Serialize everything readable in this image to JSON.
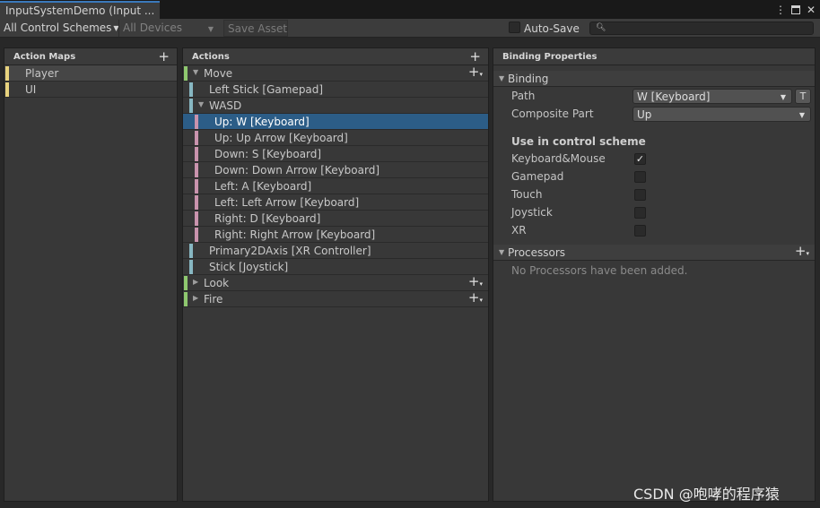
{
  "window": {
    "tab_title": "InputSystemDemo (Input ..."
  },
  "toolbar": {
    "control_schemes": "All Control Schemes",
    "devices": "All Devices",
    "save_asset": "Save Asset",
    "auto_save_label": "Auto-Save",
    "search_placeholder": ""
  },
  "action_maps": {
    "header": "Action Maps",
    "items": [
      {
        "label": "Player",
        "selected": true
      },
      {
        "label": "UI",
        "selected": false
      }
    ]
  },
  "actions": {
    "header": "Actions",
    "rows": [
      {
        "label": "Move",
        "kind": "action"
      },
      {
        "label": "Left Stick [Gamepad]",
        "kind": "binding"
      },
      {
        "label": "WASD",
        "kind": "composite"
      },
      {
        "label": "Up: W [Keyboard]",
        "kind": "part",
        "selected": true
      },
      {
        "label": "Up: Up Arrow [Keyboard]",
        "kind": "part"
      },
      {
        "label": "Down: S [Keyboard]",
        "kind": "part"
      },
      {
        "label": "Down: Down Arrow [Keyboard]",
        "kind": "part"
      },
      {
        "label": "Left: A [Keyboard]",
        "kind": "part"
      },
      {
        "label": "Left: Left Arrow [Keyboard]",
        "kind": "part"
      },
      {
        "label": "Right: D [Keyboard]",
        "kind": "part"
      },
      {
        "label": "Right: Right Arrow [Keyboard]",
        "kind": "part"
      },
      {
        "label": "Primary2DAxis [XR Controller]",
        "kind": "binding"
      },
      {
        "label": "Stick [Joystick]",
        "kind": "binding"
      },
      {
        "label": "Look",
        "kind": "action"
      },
      {
        "label": "Fire",
        "kind": "action"
      }
    ]
  },
  "binding_properties": {
    "header": "Binding Properties",
    "binding_section": "Binding",
    "path_label": "Path",
    "path_value": "W [Keyboard]",
    "t_button": "T",
    "composite_part_label": "Composite Part",
    "composite_part_value": "Up",
    "scheme_title": "Use in control scheme",
    "schemes": [
      {
        "label": "Keyboard&Mouse",
        "checked": true
      },
      {
        "label": "Gamepad",
        "checked": false
      },
      {
        "label": "Touch",
        "checked": false
      },
      {
        "label": "Joystick",
        "checked": false
      },
      {
        "label": "XR",
        "checked": false
      }
    ],
    "processors_section": "Processors",
    "processors_empty": "No Processors have been added."
  },
  "watermark": "CSDN @咆哮的程序猿",
  "colors": {
    "map_bar": "#e8d37e",
    "action_bar": "#8fc86f",
    "binding_bar": "#87b7c2",
    "part_bar": "#c993ad",
    "selection": "#2c5d87"
  }
}
